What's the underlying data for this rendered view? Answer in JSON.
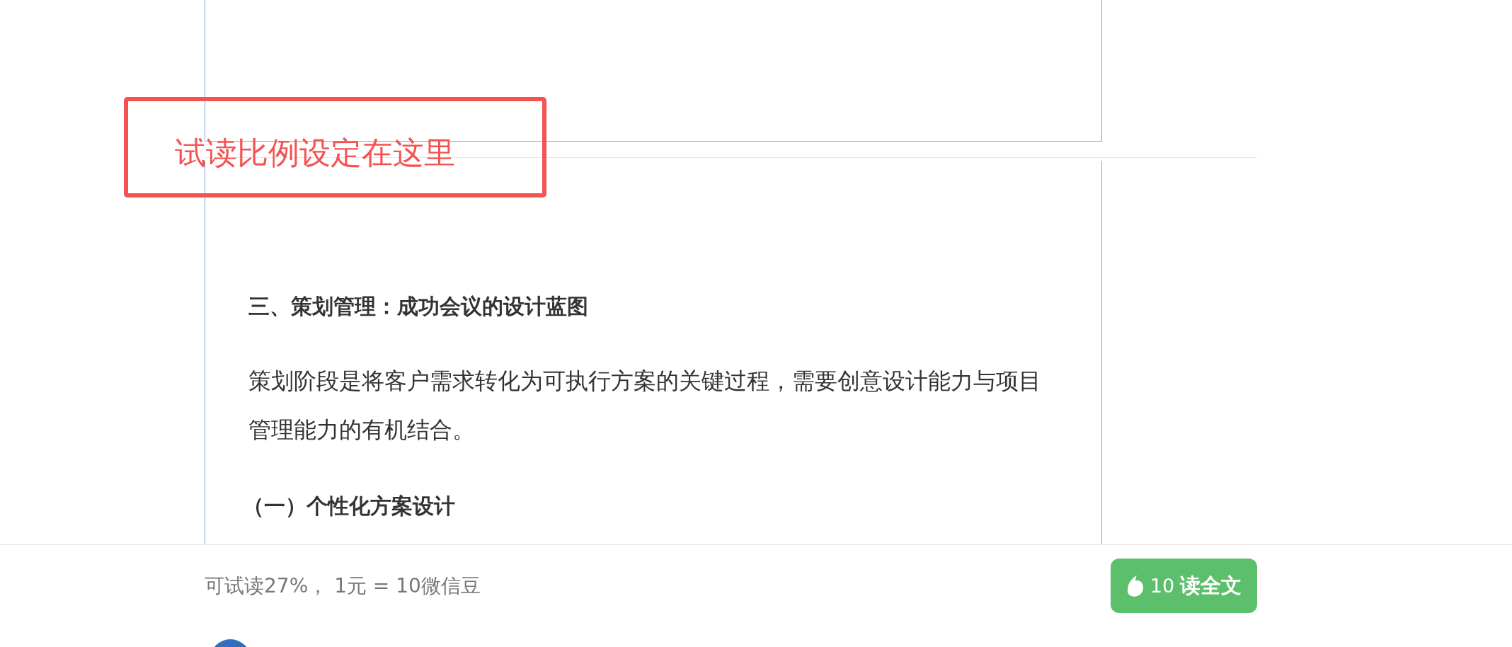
{
  "annotation": {
    "text": "试读比例设定在这里"
  },
  "document": {
    "heading": "三、策划管理：成功会议的设计蓝图",
    "paragraph": "策划阶段是将客户需求转化为可执行方案的关键过程，需要创意设计能力与项目管理能力的有机结合。",
    "subheading": "（一）个性化方案设计"
  },
  "footer": {
    "preview_note": "可试读27%， 1元 = 10微信豆",
    "button": {
      "amount": "10",
      "label": "读全文"
    }
  }
}
